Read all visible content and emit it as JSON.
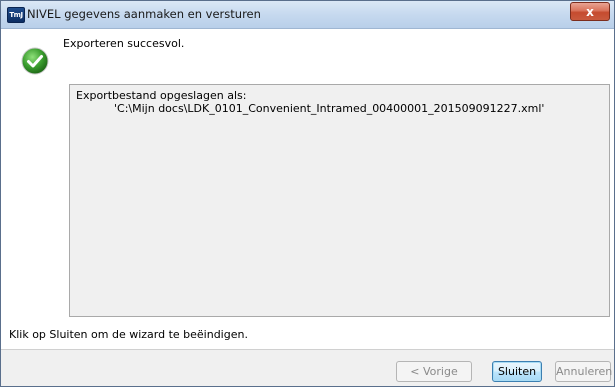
{
  "window": {
    "title": "NIVEL gegevens aanmaken en versturen",
    "app_icon_label": "TmJ",
    "close_symbol": "x"
  },
  "status": {
    "message": "Exporteren succesvol.",
    "icon": "success-check-icon",
    "icon_color": "#3a9c2e"
  },
  "result": {
    "line1": "Exportbestand opgeslagen als:",
    "line2": "'C:\\Mijn docs\\LDK_0101_Convenient_Intramed_00400001_201509091227.xml'"
  },
  "hint": "Klik op Sluiten om de wizard te beëindigen.",
  "buttons": {
    "back": "< Vorige",
    "close": "Sluiten",
    "cancel": "Annuleren"
  }
}
